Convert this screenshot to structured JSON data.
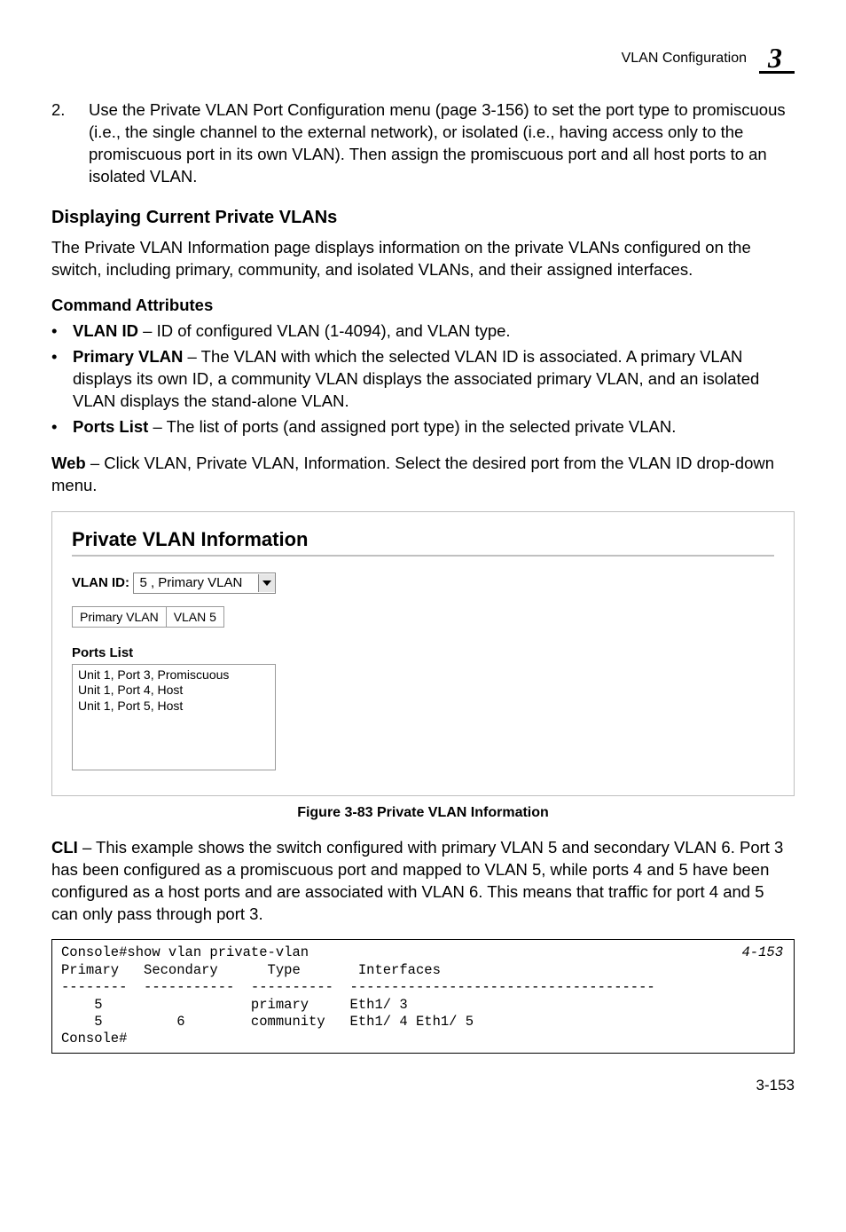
{
  "header": {
    "section_title": "VLAN Configuration",
    "chapter_glyph": "3"
  },
  "step2": {
    "num": "2.",
    "text": "Use the Private VLAN Port Configuration menu (page 3-156) to set the port type to promiscuous (i.e., the single channel to the external network), or isolated (i.e., having access only to the promiscuous port in its own VLAN). Then assign the promiscuous port and all host ports to an isolated VLAN."
  },
  "h2": "Displaying Current Private VLANs",
  "intro": "The Private VLAN Information page displays information on the private VLANs configured on the switch, including primary, community, and isolated VLANs, and their assigned interfaces.",
  "cmd_attr_heading": "Command Attributes",
  "bullets": [
    {
      "lead": "VLAN ID",
      "rest": " – ID of configured VLAN (1-4094), and VLAN type."
    },
    {
      "lead": "Primary VLAN",
      "rest": " – The VLAN with which the selected VLAN ID is associated. A primary VLAN displays its own ID, a community VLAN displays the associated primary VLAN, and an isolated VLAN displays the stand-alone VLAN."
    },
    {
      "lead": "Ports List",
      "rest": " – The list of ports (and assigned port type) in the selected private VLAN."
    }
  ],
  "web_line": {
    "lead": "Web",
    "rest": " – Click VLAN, Private VLAN, Information. Select the desired port from the VLAN ID drop-down menu."
  },
  "screenshot": {
    "title": "Private VLAN Information",
    "vlan_id_label": "VLAN ID:",
    "vlan_id_value": "5 , Primary VLAN",
    "table": {
      "h1": "Primary VLAN",
      "h2": "VLAN 5"
    },
    "ports_list_label": "Ports List",
    "ports": [
      "Unit 1, Port 3, Promiscuous",
      "Unit 1, Port 4, Host",
      "Unit 1, Port 5, Host"
    ]
  },
  "figure_caption": "Figure 3-83  Private VLAN Information",
  "cli_para": {
    "lead": "CLI",
    "rest": " – This example shows the switch configured with primary VLAN 5 and secondary VLAN 6. Port 3 has been configured as a promiscuous port and mapped to VLAN 5, while ports 4 and 5 have been configured as a host ports and are associated with VLAN 6. This means that traffic for port 4 and 5 can only pass through port 3."
  },
  "console": {
    "ref": "4-153",
    "lines": [
      "Console#show vlan private-vlan",
      "Primary   Secondary      Type       Interfaces",
      "--------  -----------  ----------  -------------------------------------",
      "    5                  primary     Eth1/ 3",
      "    5         6        community   Eth1/ 4 Eth1/ 5",
      "Console#"
    ]
  },
  "page_number": "3-153"
}
